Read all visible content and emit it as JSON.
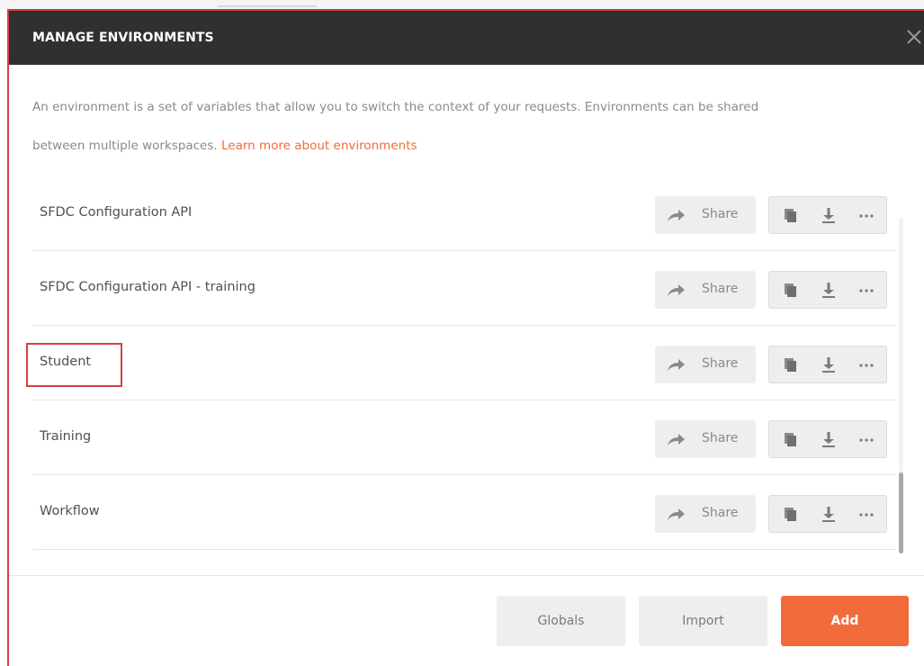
{
  "modal": {
    "title": "MANAGE ENVIRONMENTS",
    "description_line1": "An environment is a set of variables that allow you to switch the context of your requests. Environments can be shared",
    "description_line2": "between multiple workspaces.",
    "learn_more": "Learn more about environments"
  },
  "environments": [
    {
      "name": "SFDC Configuration API",
      "share_label": "Share"
    },
    {
      "name": "SFDC Configuration API - training",
      "share_label": "Share"
    },
    {
      "name": "Student",
      "share_label": "Share"
    },
    {
      "name": "Training",
      "share_label": "Share"
    },
    {
      "name": "Workflow",
      "share_label": "Share"
    }
  ],
  "footer": {
    "globals_label": "Globals",
    "import_label": "Import",
    "add_label": "Add"
  },
  "colors": {
    "header_bg": "#303030",
    "accent": "#f26b3a",
    "highlight_border": "#d64040"
  },
  "icons": {
    "close": "close-icon",
    "share": "share-arrow-icon",
    "duplicate": "duplicate-icon",
    "download": "download-icon",
    "more": "more-icon"
  }
}
